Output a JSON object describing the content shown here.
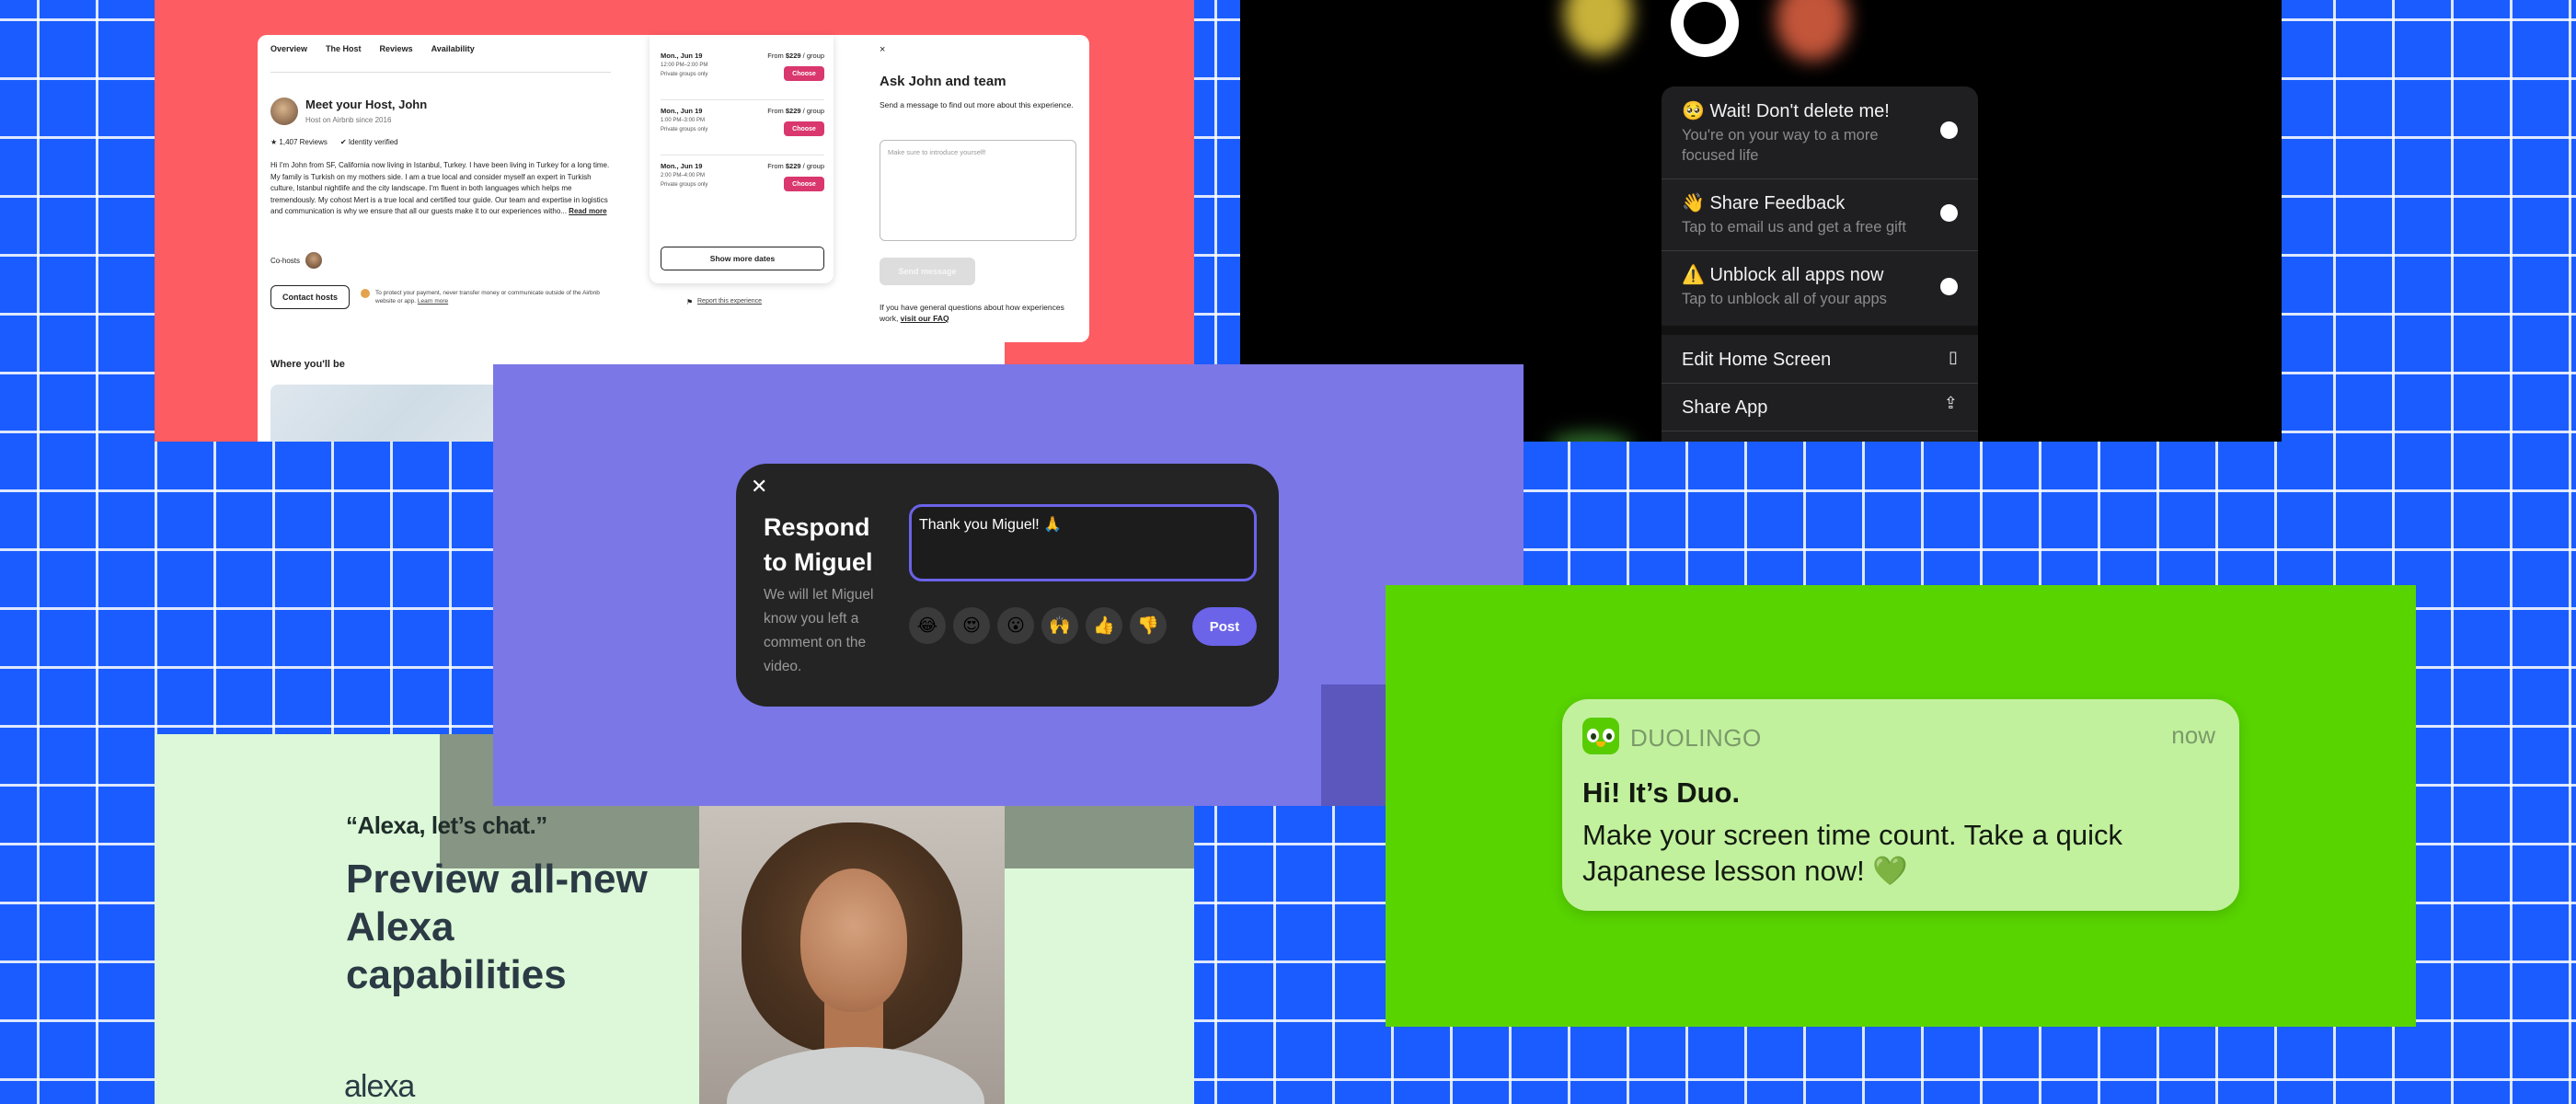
{
  "airbnb": {
    "tabs": [
      "Overview",
      "The Host",
      "Reviews",
      "Availability"
    ],
    "host_title": "Meet your Host, John",
    "host_since": "Host on Airbnb since 2016",
    "reviews": "1,407 Reviews",
    "verified": "Identity verified",
    "bio": "Hi I'm John from SF, California now living in Istanbul, Turkey. I have been living in Turkey for a long time. My family is Turkish on my mothers side. I am a true local and consider myself an expert in Turkish culture, Istanbul nightlife and the city landscape. I'm fluent in both languages which helps me tremendously. My cohost Mert is a true local and certified tour guide. Our team and expertise in logistics and communication is why we ensure that all our guests make it to our experiences witho...",
    "read_more": "Read more",
    "cohosts_label": "Co-hosts",
    "contact_button": "Contact hosts",
    "protect_note": "To protect your payment, never transfer money or communicate outside of the Airbnb website or app.",
    "learn_more": "Learn more",
    "report": "Report this experience",
    "where_title": "Where you'll be",
    "slots": [
      {
        "date": "Mon., Jun 19",
        "time": "12:00 PM–2:00 PM",
        "note": "Private groups only",
        "price_prefix": "From ",
        "price": "$229",
        "price_suffix": " / group",
        "choose": "Choose"
      },
      {
        "date": "Mon., Jun 19",
        "time": "1:00 PM–3:00 PM",
        "note": "Private groups only",
        "price_prefix": "From ",
        "price": "$229",
        "price_suffix": " / group",
        "choose": "Choose"
      },
      {
        "date": "Mon., Jun 19",
        "time": "2:00 PM–4:00 PM",
        "note": "Private groups only",
        "price_prefix": "From ",
        "price": "$229",
        "price_suffix": " / group",
        "choose": "Choose"
      }
    ],
    "show_more_dates": "Show more dates",
    "ask": {
      "close": "×",
      "title": "Ask John and team",
      "subtitle": "Send a message to find out more about this experience.",
      "placeholder": "Make sure to introduce yourself!",
      "send": "Send message",
      "faq_text": "If you have general questions about how experiences work, ",
      "faq_link": "visit our FAQ"
    }
  },
  "ios_menu": {
    "items": [
      {
        "title": "🥺 Wait! Don't delete me!",
        "subtitle": "You're on your way to a more focused life"
      },
      {
        "title": "👋 Share Feedback",
        "subtitle": "Tap to email us and get a free gift"
      },
      {
        "title": "⚠️ Unblock all apps now",
        "subtitle": "Tap to unblock all of your apps"
      }
    ],
    "edit_home": "Edit Home Screen",
    "share_app": "Share App"
  },
  "respond": {
    "close": "✕",
    "heading": "Respond to Miguel",
    "description": "We will let Miguel know you left a comment on the video.",
    "input_value": "Thank you Miguel! 🙏",
    "emojis": [
      "😂",
      "😍",
      "😮",
      "🙌",
      "👍",
      "👎"
    ],
    "post": "Post"
  },
  "alexa": {
    "quote": "“Alexa, let’s chat.”",
    "headline": "Preview all-new Alexa capabilities",
    "brand": "alexa"
  },
  "duolingo": {
    "app_name": "DUOLINGO",
    "time": "now",
    "title": "Hi! It’s Duo.",
    "body": "Make your screen time count. Take a quick Japanese lesson now! 💚"
  },
  "colors": {
    "background_blue": "#1a5cff",
    "airbnb_coral": "#fd5c63",
    "airbnb_choose": "#d9376e",
    "respond_purple": "#7b77e6",
    "post_button": "#6b63e8",
    "alexa_mint": "#dcf8d8",
    "duo_green": "#58d400",
    "duo_notification": "#c2f19d"
  }
}
